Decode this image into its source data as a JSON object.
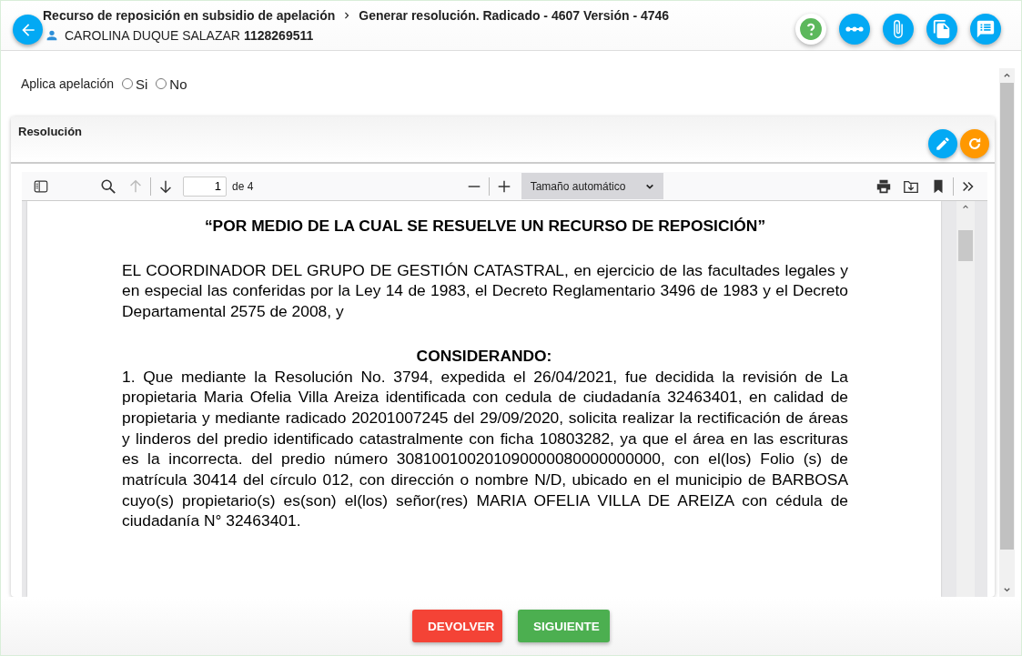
{
  "header": {
    "breadcrumb": [
      "Recurso de reposición en subsidio de apelación",
      "Generar resolución. Radicado - 4607 Versión - 4746"
    ],
    "user_name": "CAROLINA DUQUE SALAZAR",
    "user_id": "1128269511",
    "actions": [
      {
        "kind": "help"
      },
      {
        "kind": "steps"
      },
      {
        "kind": "attach"
      },
      {
        "kind": "copy"
      },
      {
        "kind": "notes"
      }
    ]
  },
  "appeal": {
    "label": "Aplica apelación",
    "options": [
      {
        "label": "Si",
        "selected": false
      },
      {
        "label": "No",
        "selected": false
      }
    ]
  },
  "card": {
    "title": "Resolución",
    "actions": [
      {
        "kind": "edit"
      },
      {
        "kind": "refresh"
      }
    ]
  },
  "viewer": {
    "page": "1",
    "page_count": "de 4",
    "zoom": "Tamaño automático",
    "blocks": [
      {
        "kind": "title",
        "text": "“POR MEDIO DE LA CUAL SE RESUELVE UN RECURSO DE REPOSICIÓN”"
      },
      {
        "kind": "paragraph",
        "text": "EL COORDINADOR DEL GRUPO DE GESTIÓN CATASTRAL, en ejercicio de las facultades legales y en especial las conferidas por la Ley 14 de 1983, el Decreto Reglamentario 3496 de 1983 y el Decreto Departamental 2575 de 2008, y"
      },
      {
        "kind": "heading",
        "text": "CONSIDERANDO:"
      },
      {
        "kind": "paragraph",
        "text": "1. Que mediante la Resolución No. 3794, expedida el 26/04/2021, fue decidida la revisión de La propietaria Maria Ofelia Villa Areiza identificada con cedula de ciudadanía 32463401, en calidad de propietaria y mediante radicado 20201007245 del 29/09/2020, solicita realizar la rectificación de áreas y linderos del predio identificado catastralmente con ficha 10803282, ya que el área en las escrituras es la incorrecta. del predio número 308100100201090000080000000000, con el(los) Folio (s) de matrícula 30414 del círculo 012, con dirección o nombre N/D, ubicado en el municipio de BARBOSA cuyo(s) propietario(s) es(son) el(los) señor(res) MARIA OFELIA VILLA DE AREIZA con cédula de ciudadanía N° 32463401."
      }
    ]
  },
  "buttons": [
    {
      "label": "DEVOLVER",
      "kind": "danger"
    },
    {
      "label": "SIGUIENTE",
      "kind": "success"
    }
  ]
}
